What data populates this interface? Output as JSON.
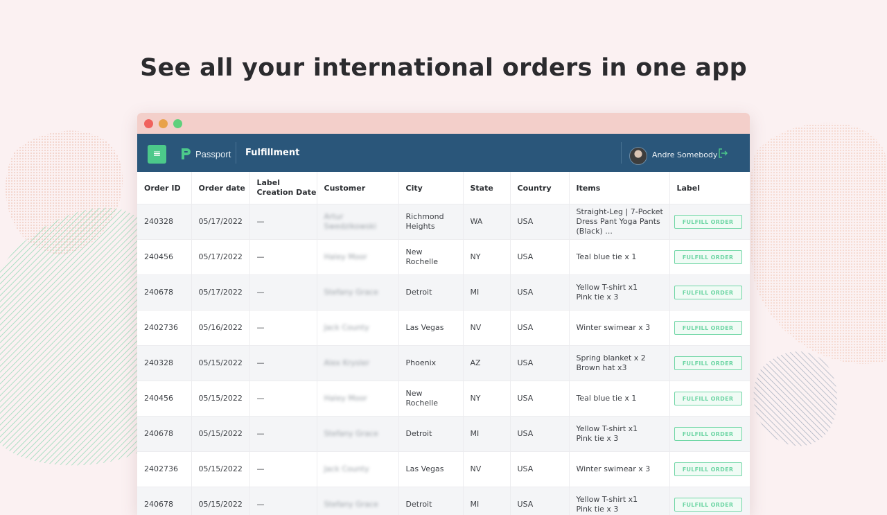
{
  "headline": "See all your international orders in one app",
  "appbar": {
    "brand": "Passport",
    "section_title": "Fulfillment",
    "user_name": "Andre Somebody"
  },
  "table": {
    "headers": {
      "order_id": "Order ID",
      "order_date": "Order date",
      "label_creation_1": "Label",
      "label_creation_2": "Creation Date",
      "customer": "Customer",
      "city": "City",
      "state": "State",
      "country": "Country",
      "items": "Items",
      "label": "Label"
    },
    "rows": [
      {
        "id": "240328",
        "date": "05/17/2022",
        "label_date": "—",
        "customer": "Artur Swedzikowski",
        "city": "Richmond Heights",
        "state": "WA",
        "country": "USA",
        "items": [
          "Straight-Leg | 7-Pocket",
          "Dress Pant Yoga Pants",
          "(Black) ..."
        ],
        "action": "FULFILL ORDER"
      },
      {
        "id": "240456",
        "date": "05/17/2022",
        "label_date": "—",
        "customer": "Haley Moor",
        "city": "New Rochelle",
        "state": "NY",
        "country": "USA",
        "items": [
          "Teal blue tie x 1"
        ],
        "action": "FULFILL ORDER"
      },
      {
        "id": "240678",
        "date": "05/17/2022",
        "label_date": "—",
        "customer": "Stefany Grace",
        "city": "Detroit",
        "state": "MI",
        "country": "USA",
        "items": [
          "Yellow T-shirt x1",
          "Pink tie x 3"
        ],
        "action": "FULFILL ORDER"
      },
      {
        "id": "2402736",
        "date": "05/16/2022",
        "label_date": "—",
        "customer": "Jack County",
        "city": "Las Vegas",
        "state": "NV",
        "country": "USA",
        "items": [
          "Winter swimear x 3"
        ],
        "action": "FULFILL ORDER"
      },
      {
        "id": "240328",
        "date": "05/15/2022",
        "label_date": "—",
        "customer": "Alex Krysler",
        "city": "Phoenix",
        "state": "AZ",
        "country": "USA",
        "items": [
          "Spring blanket x 2",
          "Brown hat x3"
        ],
        "action": "FULFILL ORDER"
      },
      {
        "id": "240456",
        "date": "05/15/2022",
        "label_date": "—",
        "customer": "Haley Moor",
        "city": "New Rochelle",
        "state": "NY",
        "country": "USA",
        "items": [
          "Teal blue tie x 1"
        ],
        "action": "FULFILL ORDER"
      },
      {
        "id": "240678",
        "date": "05/15/2022",
        "label_date": "—",
        "customer": "Stefany Grace",
        "city": "Detroit",
        "state": "MI",
        "country": "USA",
        "items": [
          "Yellow T-shirt x1",
          "Pink tie x 3"
        ],
        "action": "FULFILL ORDER"
      },
      {
        "id": "2402736",
        "date": "05/15/2022",
        "label_date": "—",
        "customer": "Jack County",
        "city": "Las Vegas",
        "state": "NV",
        "country": "USA",
        "items": [
          "Winter swimear x 3"
        ],
        "action": "FULFILL ORDER"
      },
      {
        "id": "240678",
        "date": "05/15/2022",
        "label_date": "—",
        "customer": "Stefany Grace",
        "city": "Detroit",
        "state": "MI",
        "country": "USA",
        "items": [
          "Yellow T-shirt x1",
          "Pink tie x 3"
        ],
        "action": "FULFILL ORDER"
      }
    ]
  },
  "colors": {
    "background": "#fbf1f2",
    "titlebar": "#f3cfca",
    "appbar": "#2a567a",
    "accent_green": "#4cc98a",
    "button_outline": "#6fd6a5"
  },
  "icons": {
    "menu": "hamburger-icon",
    "logo": "passport-logo-icon",
    "logout": "logout-icon"
  }
}
